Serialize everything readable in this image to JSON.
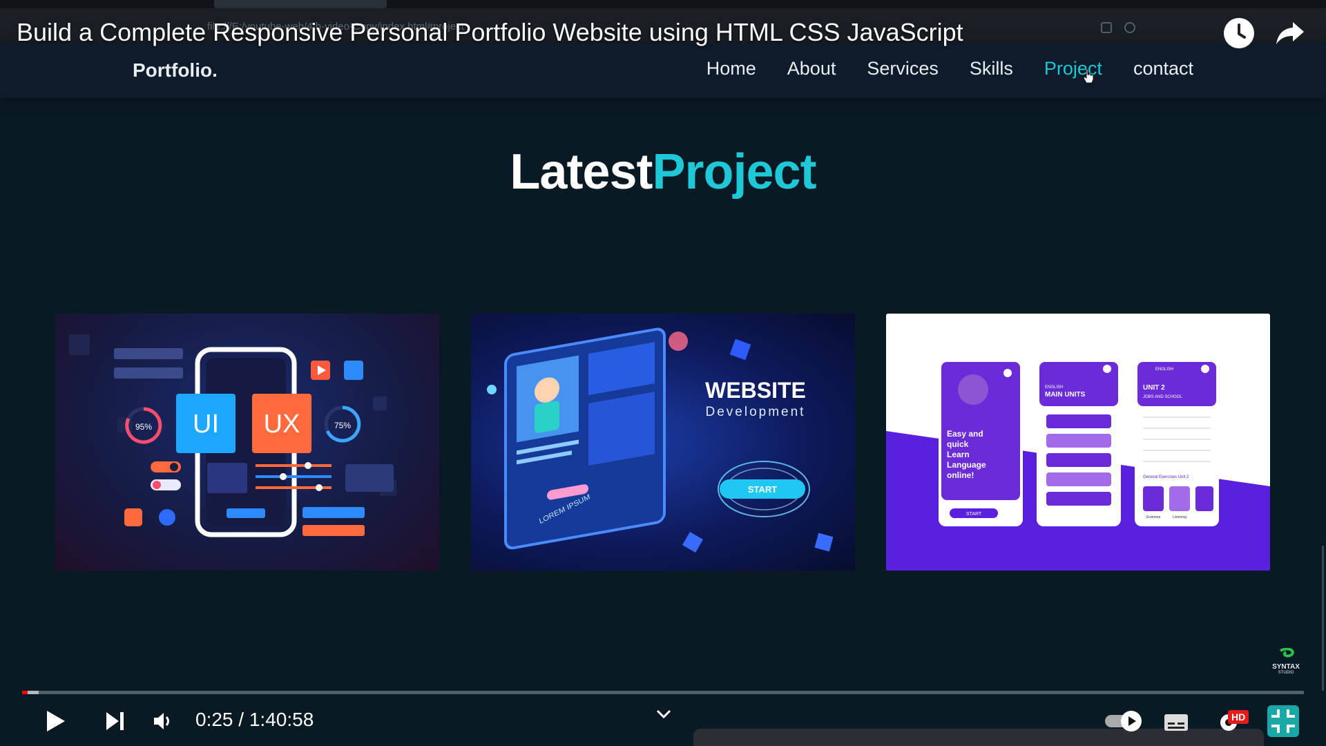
{
  "video": {
    "title": "Build a Complete Responsive Personal Portfolio Website using HTML CSS JavaScript",
    "time_current": "0:25",
    "time_separator": " / ",
    "time_total": "1:40:58",
    "progress": 0.0041,
    "buffered": 0.013,
    "quality_badge": "HD",
    "progress_color": "#ff0000"
  },
  "browser": {
    "url": "file:///E:/youtube-web/4th-video-Copy/index.html#project"
  },
  "site": {
    "logo": "Portfolio.",
    "nav": [
      {
        "label": "Home",
        "active": false
      },
      {
        "label": "About",
        "active": false
      },
      {
        "label": "Services",
        "active": false
      },
      {
        "label": "Skills",
        "active": false
      },
      {
        "label": "Project",
        "active": true
      },
      {
        "label": "contact",
        "active": false
      }
    ],
    "accent": "#1ec8d6",
    "section_title_white": "Latest",
    "section_title_accent": "Project"
  },
  "cards": {
    "card1": {
      "ui": "UI",
      "ux": "UX",
      "pct_left": "95%",
      "pct_right": "75%"
    },
    "card2": {
      "heading": "WEBSITE",
      "sub": "Development",
      "button": "START",
      "lorem": "LOREM IPSUM"
    },
    "card3": {
      "phone1_text": [
        "Easy and",
        "quick",
        "Learn",
        "Language",
        "online!"
      ],
      "phone1_button": "START",
      "phone2_small": "ENGLISH",
      "phone2_title": "MAIN UNITS",
      "phone3_small": "ENGLISH",
      "phone3_title": "UNIT 2",
      "phone3_sub": "JOBS AND SCHOOL",
      "phone3_section": "General Exercises Unit 2",
      "phone3_btn1": "Grammar",
      "phone3_btn2": "Listening"
    }
  },
  "watermark": {
    "text": "SYNTAX",
    "sub": "STUDIO"
  }
}
